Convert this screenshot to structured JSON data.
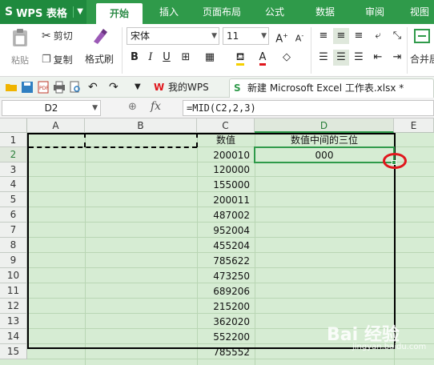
{
  "app": {
    "name": "WPS 表格",
    "logo": "S"
  },
  "menu_tabs": [
    "开始",
    "插入",
    "页面布局",
    "公式",
    "数据",
    "审阅",
    "视图"
  ],
  "ribbon": {
    "paste": "粘贴",
    "cut": "剪切",
    "copy": "复制",
    "format_painter": "格式刷",
    "font_name": "宋体",
    "font_size": "11",
    "merge": "合并居"
  },
  "doc_tabs": [
    {
      "label": "我的WPS"
    },
    {
      "label": "新建 Microsoft Excel 工作表.xlsx *"
    }
  ],
  "formula_bar": {
    "name_box": "D2",
    "fx": "fx",
    "formula": "=MID(C2,2,3)"
  },
  "columns": [
    "A",
    "B",
    "C",
    "D",
    "E"
  ],
  "rows": [
    "1",
    "2",
    "3",
    "4",
    "5",
    "6",
    "7",
    "8",
    "9",
    "10",
    "11",
    "12",
    "13",
    "14",
    "15"
  ],
  "cells": {
    "C": [
      "数值",
      "200010",
      "120000",
      "155000",
      "200011",
      "487002",
      "952004",
      "455204",
      "785622",
      "473250",
      "689206",
      "215200",
      "362020",
      "552200",
      "785552"
    ],
    "D": [
      "数值中间的三位",
      "000"
    ]
  },
  "watermark": {
    "main": "Bai 经验",
    "sub": "jingyan.baidu.com"
  },
  "colors": {
    "brand": "#2f9a4a",
    "sheet_bg": "#d6ecd3",
    "annotation": "#e0161c"
  }
}
